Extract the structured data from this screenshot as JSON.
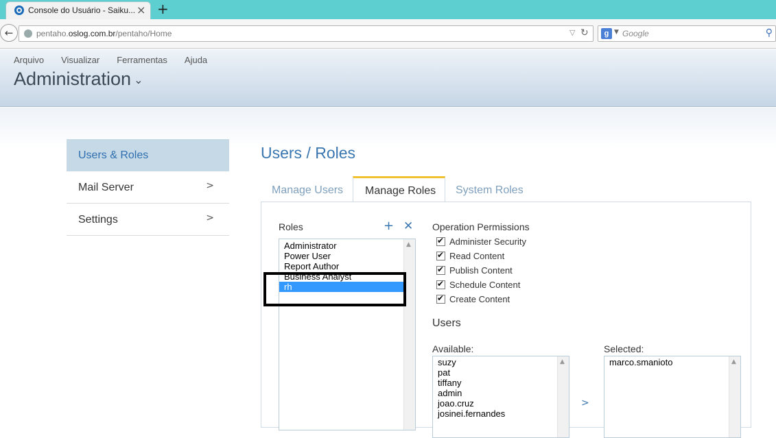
{
  "browser": {
    "tab_title": "Console do Usuário - Saiku...",
    "tab_close": "×",
    "new_tab": "+",
    "url_host": "pentaho.oslog.com.br",
    "url_prefix": "pentaho.",
    "url_domain": "oslog.com.br",
    "url_path": "/pentaho/Home",
    "search_placeholder": "Google",
    "search_engine_letter": "g"
  },
  "app": {
    "menu": [
      "Arquivo",
      "Visualizar",
      "Ferramentas",
      "Ajuda"
    ],
    "perspective": "Administration"
  },
  "sidebar": {
    "items": [
      {
        "label": "Users & Roles",
        "active": true
      },
      {
        "label": "Mail Server",
        "active": false
      },
      {
        "label": "Settings",
        "active": false
      }
    ]
  },
  "main": {
    "title": "Users / Roles",
    "tabs": [
      "Manage Users",
      "Manage Roles",
      "System Roles"
    ],
    "active_tab": "Manage Roles"
  },
  "roles": {
    "label": "Roles",
    "items": [
      "Administrator",
      "Power User",
      "Report Author",
      "Business Analyst",
      "rh"
    ],
    "selected": "rh"
  },
  "permissions": {
    "title": "Operation Permissions",
    "items": [
      {
        "label": "Administer Security",
        "checked": true
      },
      {
        "label": "Read Content",
        "checked": true
      },
      {
        "label": "Publish Content",
        "checked": true
      },
      {
        "label": "Schedule Content",
        "checked": true
      },
      {
        "label": "Create Content",
        "checked": true
      }
    ]
  },
  "users": {
    "title": "Users",
    "available_label": "Available:",
    "selected_label": "Selected:",
    "available": [
      "suzy",
      "pat",
      "tiffany",
      "admin",
      "joao.cruz",
      "josinei.fernandes"
    ],
    "selected": [
      "marco.smanioto"
    ]
  },
  "colors": {
    "tabbar": "#5ecfd0",
    "accent_blue": "#3a77b0",
    "active_tab_top": "#f1c232",
    "selection": "#3399ff",
    "sidebar_active": "#c5d9e7"
  }
}
